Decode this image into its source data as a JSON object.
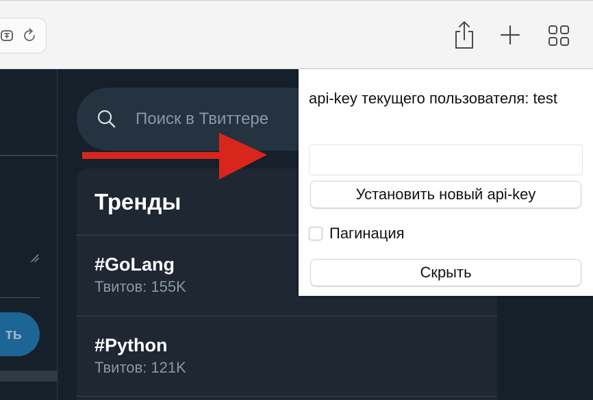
{
  "browser": {
    "icons": {
      "translate": "translate-icon",
      "reload": "reload-icon",
      "share": "share-icon",
      "new_tab": "plus-icon",
      "tab_overview": "grid-icon"
    }
  },
  "twitter": {
    "sidebar": {
      "tweet_button_label": "ть"
    },
    "search": {
      "placeholder": "Поиск в Твиттере"
    },
    "trends": {
      "title": "Тренды",
      "items": [
        {
          "tag": "#GoLang",
          "count": "Твитов: 155K"
        },
        {
          "tag": "#Python",
          "count": "Твитов: 121K"
        }
      ]
    }
  },
  "popup": {
    "label": "api-key текущего пользователя: test",
    "api_key_value": "",
    "set_button_label": "Установить новый api-key",
    "pagination_label": "Пагинация",
    "pagination_checked": false,
    "hide_button_label": "Скрыть"
  },
  "colors": {
    "page_background": "#15202b",
    "card_background": "#1e2732",
    "arrow": "#d9261c",
    "accent_button": "#1d6595"
  }
}
